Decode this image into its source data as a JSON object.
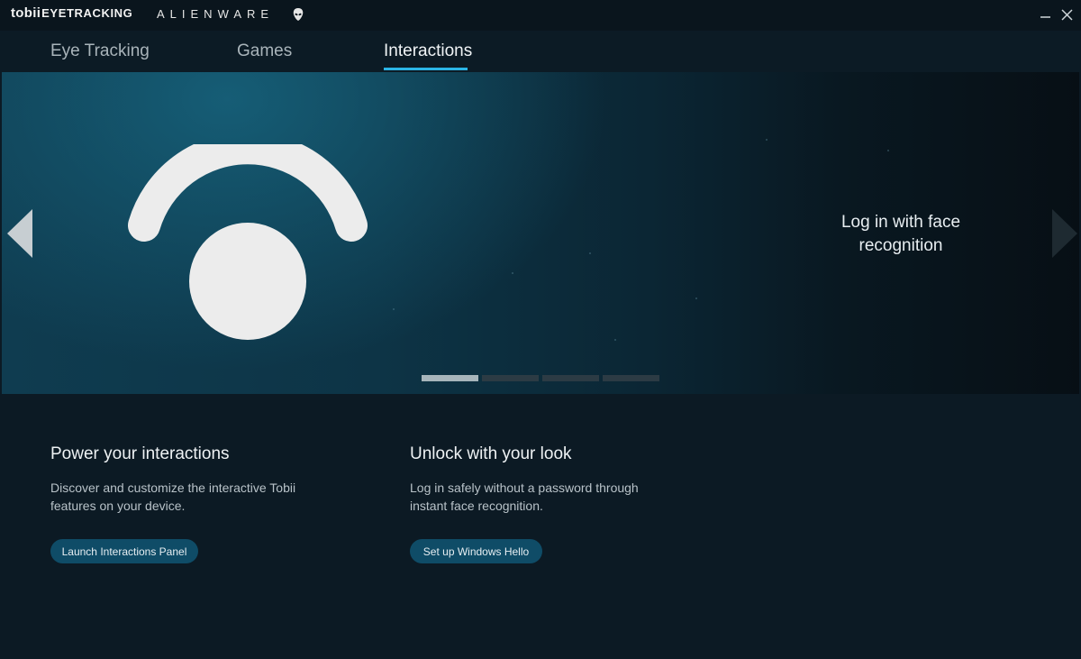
{
  "titlebar": {
    "brand_prefix": "tobii",
    "brand_suffix": "EYETRACKING",
    "partner": "ALIENWARE",
    "partner_icon": "alien-head-icon",
    "minimize_icon": "minimize-icon",
    "close_icon": "close-icon"
  },
  "tabs": [
    {
      "label": "Eye Tracking",
      "active": false
    },
    {
      "label": "Games",
      "active": false
    },
    {
      "label": "Interactions",
      "active": true
    }
  ],
  "hero": {
    "caption": "Log in with face recognition",
    "graphic_icon": "face-recognition-icon",
    "prev_icon": "arrow-left-icon",
    "next_icon": "arrow-right-icon",
    "pages_total": 4,
    "active_page": 1
  },
  "cards": [
    {
      "title": "Power your interactions",
      "description": "Discover and customize the interactive Tobii features on your device.",
      "button": "Launch Interactions Panel"
    },
    {
      "title": "Unlock with your look",
      "description": "Log in safely without a password through instant face recognition.",
      "button": "Set up Windows Hello"
    }
  ],
  "colors": {
    "accent": "#2bb5e6",
    "button": "#0f4c67",
    "background": "#0c1a24"
  }
}
